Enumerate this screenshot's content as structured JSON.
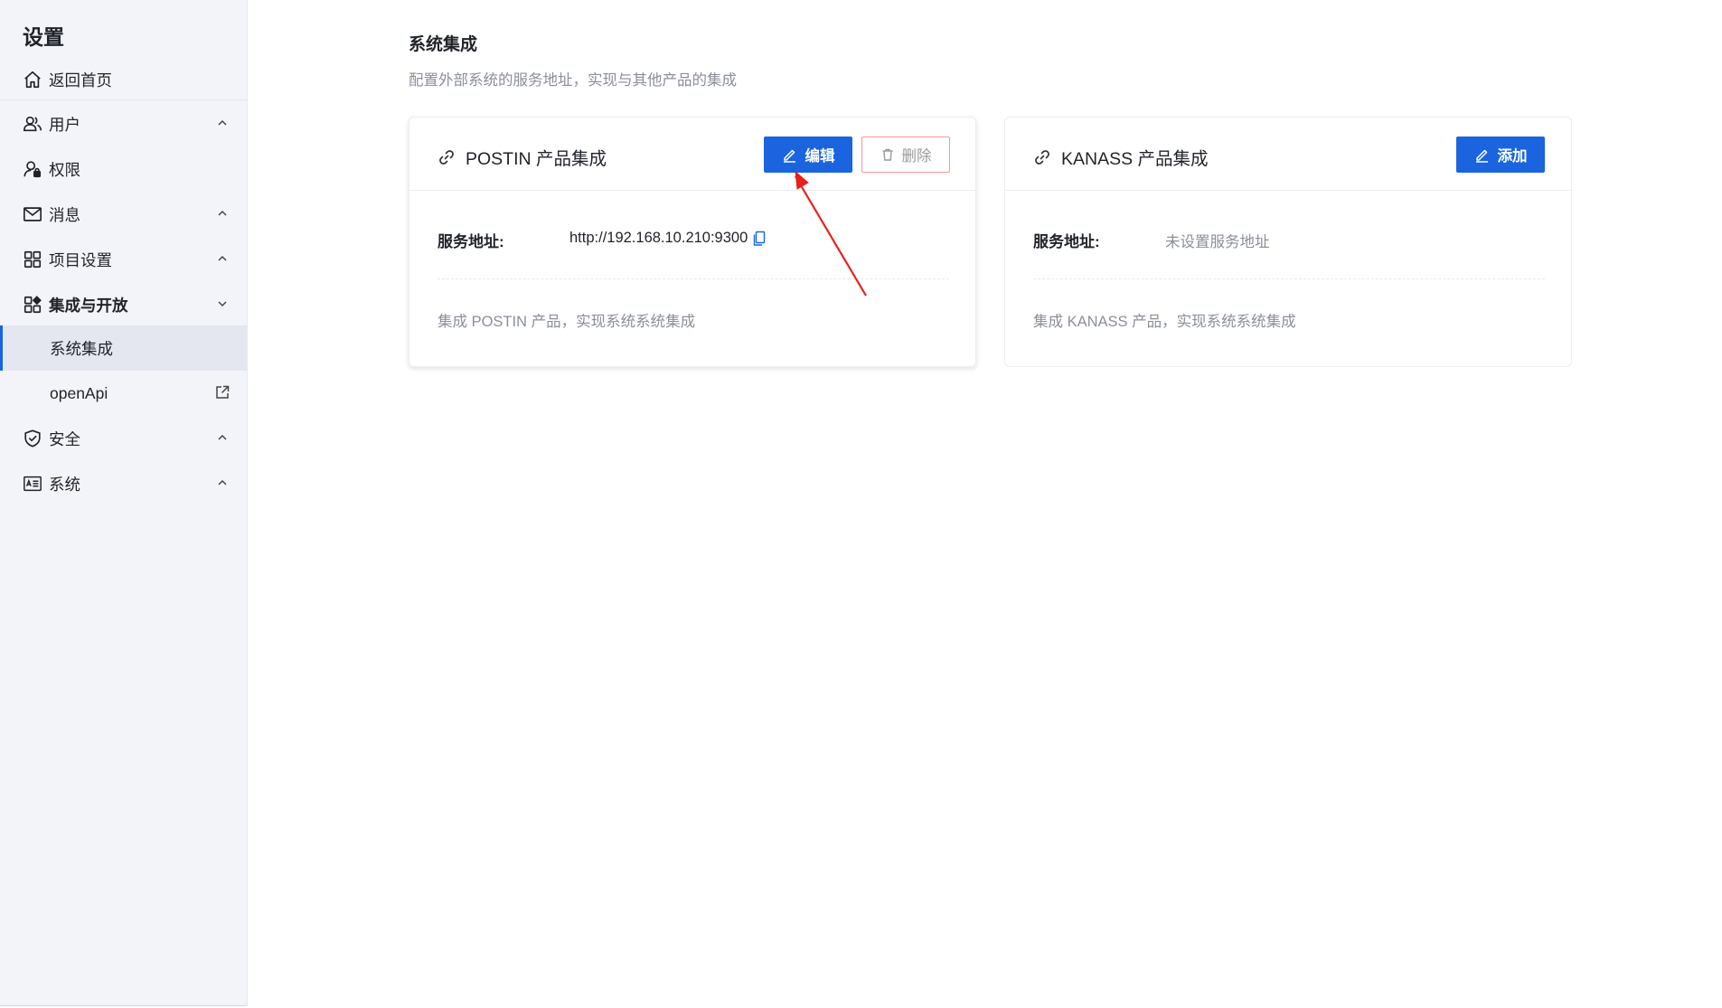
{
  "sidebar": {
    "title": "设置",
    "items": [
      {
        "label": "返回首页",
        "icon": "home-icon"
      },
      {
        "label": "用户",
        "icon": "user-icon"
      },
      {
        "label": "权限",
        "icon": "permission-icon"
      },
      {
        "label": "消息",
        "icon": "mail-icon"
      },
      {
        "label": "项目设置",
        "icon": "grid-icon"
      },
      {
        "label": "集成与开放",
        "icon": "apps-icon"
      },
      {
        "label": "系统集成"
      },
      {
        "label": "openApi",
        "icon": "external-link-icon"
      },
      {
        "label": "安全",
        "icon": "shield-icon"
      },
      {
        "label": "系统",
        "icon": "id-card-icon"
      }
    ]
  },
  "main": {
    "heading": "系统集成",
    "subheading": "配置外部系统的服务地址，实现与其他产品的集成",
    "cards": [
      {
        "title": "POSTIN 产品集成",
        "edit_label": "编辑",
        "delete_label": "删除",
        "field_label": "服务地址:",
        "field_value": "http://192.168.10.210:9300",
        "description": "集成 POSTIN 产品，实现系统系统集成"
      },
      {
        "title": "KANASS 产品集成",
        "add_label": "添加",
        "field_label": "服务地址:",
        "field_value": "未设置服务地址",
        "description": "集成 KANASS 产品，实现系统系统集成"
      }
    ]
  },
  "colors": {
    "primary": "#1a64e0",
    "danger_border": "#f09a9a",
    "annotation_arrow": "#e8201c",
    "sidebar_bg": "#f3f4f9"
  }
}
